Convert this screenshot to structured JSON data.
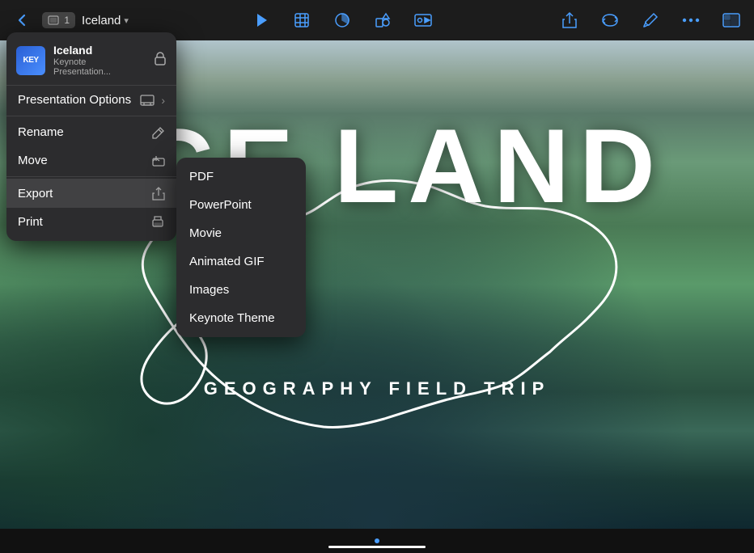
{
  "toolbar": {
    "back_label": "‹",
    "slides_count": "1",
    "title": "Iceland",
    "title_arrow": "▾",
    "play_icon": "▶",
    "table_icon": "⊞",
    "chart_icon": "◷",
    "shapes_icon": "❏",
    "media_icon": "▭",
    "share_icon": "⬆",
    "loop_icon": "↻",
    "brush_icon": "✏",
    "more_icon": "···",
    "nav_icon": "⊡"
  },
  "file_popup": {
    "name": "Iceland",
    "subtitle": "Keynote Presentation...",
    "lock_icon": "🔒"
  },
  "main_menu": {
    "items": [
      {
        "label": "Presentation Options",
        "icon": "▭",
        "has_arrow": true,
        "is_selected": false
      },
      {
        "label": "Rename",
        "icon": "✎",
        "has_arrow": false,
        "is_selected": false
      },
      {
        "label": "Move",
        "icon": "▤",
        "has_arrow": false,
        "is_selected": false
      },
      {
        "label": "Export",
        "icon": "⬆",
        "has_arrow": false,
        "is_selected": true
      },
      {
        "label": "Print",
        "icon": "⎙",
        "has_arrow": false,
        "is_selected": false
      }
    ]
  },
  "export_submenu": {
    "items": [
      {
        "label": "PDF",
        "is_active": false
      },
      {
        "label": "PowerPoint",
        "is_active": false
      },
      {
        "label": "Movie",
        "is_active": false
      },
      {
        "label": "Animated GIF",
        "is_active": false
      },
      {
        "label": "Images",
        "is_active": false
      },
      {
        "label": "Keynote Theme",
        "is_active": false
      }
    ]
  },
  "slide": {
    "title": "ICE LAND",
    "subtitle": "GEOGRAPHY FIELD TRIP"
  },
  "bottom": {
    "indicator": "●"
  }
}
